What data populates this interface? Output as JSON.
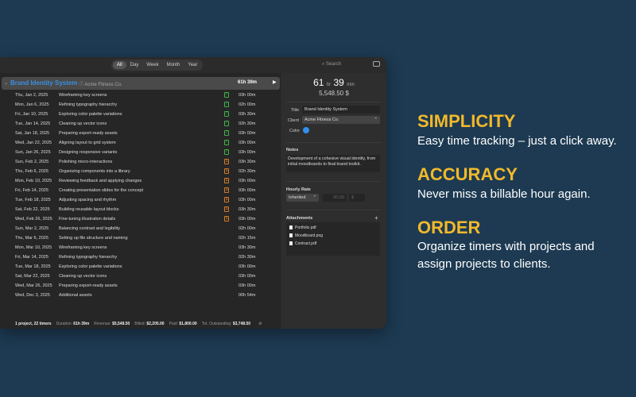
{
  "toolbar": {
    "filters": [
      "All",
      "Day",
      "Week",
      "Month",
      "Year"
    ],
    "search_placeholder": "Search"
  },
  "project": {
    "name": "Brand Identity System",
    "client": "Acme Fitness Co.",
    "duration": "61h 39m"
  },
  "rows": [
    {
      "date": "Thu, Jan 2, 2025",
      "desc": "Wireframing key screens",
      "status": "paid",
      "dur": "03h 00m"
    },
    {
      "date": "Mon, Jan 6, 2025",
      "desc": "Refining typography hierarchy",
      "status": "paid",
      "dur": "02h 00m"
    },
    {
      "date": "Fri, Jan 10, 2025",
      "desc": "Exploring color palette variations",
      "status": "paid",
      "dur": "03h 30m"
    },
    {
      "date": "Tue, Jan 14, 2025",
      "desc": "Cleaning up vector icons",
      "status": "paid",
      "dur": "02h 30m"
    },
    {
      "date": "Sat, Jan 18, 2025",
      "desc": "Preparing export-ready assets",
      "status": "paid",
      "dur": "03h 00m"
    },
    {
      "date": "Wed, Jan 22, 2025",
      "desc": "Aligning layout to grid system",
      "status": "paid",
      "dur": "03h 00m"
    },
    {
      "date": "Sun, Jan 26, 2025",
      "desc": "Designing responsive variants",
      "status": "paid",
      "dur": "03h 00m"
    },
    {
      "date": "Sun, Feb 2, 2025",
      "desc": "Polishing micro-interactions",
      "status": "billed",
      "dur": "03h 30m"
    },
    {
      "date": "Thu, Feb 6, 2025",
      "desc": "Organizing components into a library",
      "status": "billed",
      "dur": "02h 30m"
    },
    {
      "date": "Mon, Feb 10, 2025",
      "desc": "Reviewing feedback and applying changes",
      "status": "billed",
      "dur": "03h 00m"
    },
    {
      "date": "Fri, Feb 14, 2025",
      "desc": "Creating presentation slides for the concept",
      "status": "billed",
      "dur": "03h 00m"
    },
    {
      "date": "Tue, Feb 18, 2025",
      "desc": "Adjusting spacing and rhythm",
      "status": "billed",
      "dur": "03h 00m"
    },
    {
      "date": "Sat, Feb 22, 2025",
      "desc": "Building reusable layout blocks",
      "status": "billed",
      "dur": "03h 30m"
    },
    {
      "date": "Wed, Feb 26, 2025",
      "desc": "Fine-tuning illustration details",
      "status": "billed",
      "dur": "03h 00m"
    },
    {
      "date": "Sun, Mar 2, 2025",
      "desc": "Balancing contrast and legibility",
      "status": "",
      "dur": "02h 00m"
    },
    {
      "date": "Thu, Mar 6, 2025",
      "desc": "Setting up file structure and naming",
      "status": "",
      "dur": "02h 15m"
    },
    {
      "date": "Mon, Mar 10, 2025",
      "desc": "Wireframing key screens",
      "status": "",
      "dur": "03h 30m"
    },
    {
      "date": "Fri, Mar 14, 2025",
      "desc": "Refining typography hierarchy",
      "status": "",
      "dur": "02h 30m"
    },
    {
      "date": "Tue, Mar 18, 2025",
      "desc": "Exploring color palette variations",
      "status": "",
      "dur": "03h 00m"
    },
    {
      "date": "Sat, Mar 22, 2025",
      "desc": "Cleaning up vector icons",
      "status": "",
      "dur": "03h 00m"
    },
    {
      "date": "Wed, Mar 26, 2025",
      "desc": "Preparing export-ready assets",
      "status": "",
      "dur": "03h 00m"
    },
    {
      "date": "Wed, Dec 3, 2025",
      "desc": "Additional assets",
      "status": "",
      "dur": "00h 54m"
    }
  ],
  "footer": {
    "summary": "1 project, 22 timers",
    "duration_label": "Duration:",
    "duration": "61h 39m",
    "revenue_label": "Revenue:",
    "revenue": "$5,548.50",
    "billed_label": "Billed:",
    "billed": "$2,205.00",
    "paid_label": "Paid:",
    "paid": "$1,800.00",
    "outstanding_label": "Tot. Outstanding:",
    "outstanding": "$3,748.50"
  },
  "inspector": {
    "hours": "61",
    "hr_unit": "hr",
    "minutes": "39",
    "min_unit": "min",
    "amount": "5,548.50 $",
    "title_label": "Title",
    "title": "Brand Identity System",
    "client_label": "Client",
    "client": "Acme Fitness Co.",
    "color_label": "Color",
    "color": "#2f8ff0",
    "notes_label": "Notes",
    "notes": "Development of a cohesive visual identity, from initial moodboards to final brand toolkit.",
    "rate_label": "Hourly Rate",
    "rate_mode": "Inherited",
    "rate": "90.00",
    "currency": "$",
    "attachments_label": "Attachments",
    "add": "+",
    "attachments": [
      "Portfolio.pdf",
      "Moodboard.png",
      "Contract.pdf"
    ]
  },
  "marketing": [
    {
      "heading": "SIMPLICITY",
      "body": "Easy time tracking – just a click away."
    },
    {
      "heading": "ACCURACY",
      "body": "Never miss a billable hour again."
    },
    {
      "heading": "ORDER",
      "body": "Organize timers with projects and assign projects to clients."
    }
  ]
}
